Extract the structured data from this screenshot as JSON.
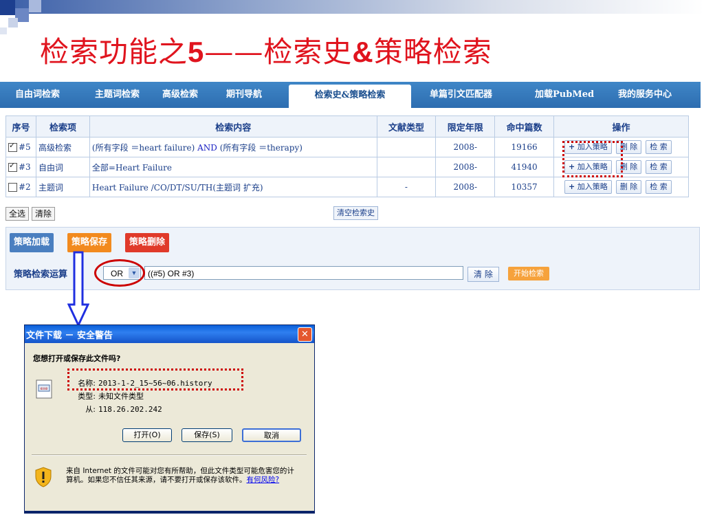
{
  "slide": {
    "title_pre": "检索功能之",
    "title_num": "5",
    "title_dash": "——",
    "title_mid": "检索史",
    "title_amp": "&",
    "title_post": "策略检索"
  },
  "tabs": [
    {
      "label": "自由词检索"
    },
    {
      "label": "主题词检索"
    },
    {
      "label": "高级检索"
    },
    {
      "label": "期刊导航"
    },
    {
      "label": "检索史&策略检索",
      "active": true
    },
    {
      "label": "单篇引文匹配器"
    },
    {
      "label": "加载PubMed"
    },
    {
      "label": "我的服务中心"
    }
  ],
  "history": {
    "headers": [
      "序号",
      "检索项",
      "检索内容",
      "文献类型",
      "限定年限",
      "命中篇数",
      "操作"
    ],
    "rows": [
      {
        "checked": true,
        "id": "#5",
        "item": "高级检索",
        "content_a": "(所有字段 ＝heart failure) ",
        "content_and": "AND",
        "content_b": " (所有字段 ＝therapy)",
        "doc_type": "",
        "year": "2008-",
        "hits": "19166"
      },
      {
        "checked": true,
        "id": "#3",
        "item": "自由词",
        "content": "全部=Heart Failure",
        "doc_type": "",
        "year": "2008-",
        "hits": "41940"
      },
      {
        "checked": false,
        "id": "#2",
        "item": "主题词",
        "content": "Heart Failure /CO/DT/SU/TH(主题词 扩充)",
        "doc_type": "-",
        "year": "2008-",
        "hits": "10357"
      }
    ],
    "ops": {
      "add_plus": "+",
      "add": "加入策略",
      "delete": "删 除",
      "search": "检 索"
    },
    "select_all": "全选",
    "clear": "清除",
    "clear_history": "清空检索史"
  },
  "strategy": {
    "load": "策略加载",
    "save": "策略保存",
    "delete": "策略删除",
    "op_label": "策略检索运算",
    "operator": "OR",
    "expression": "((#5) OR #3)",
    "clear_btn": "清 除",
    "start_btn": "开始检索"
  },
  "dialog": {
    "title": "文件下载 － 安全警告",
    "close": "✕",
    "question": "您想打开或保存此文件吗?",
    "name_label": "名称:",
    "name_value": "2013-1-2_15~56~06.history",
    "type_label": "类型:",
    "type_value": "未知文件类型",
    "from_label": "从:",
    "from_value": "118.26.202.242",
    "open_btn": "打开(O)",
    "save_btn": "保存(S)",
    "cancel_btn": "取消",
    "warning": "来自 Internet 的文件可能对您有所帮助，但此文件类型可能危害您的计算机。如果您不信任其来源，请不要打开或保存该软件。",
    "risk_link": "有何风险?"
  },
  "colors": {
    "title_red": "#e0141e",
    "tab_blue": "#2d6db0",
    "link_blue": "#1b3f8a",
    "load_btn": "#4a7fc0",
    "save_btn": "#f28a1e",
    "delete_btn": "#e03a2a",
    "annotation_red": "#cc0000",
    "arrow_blue": "#1f2fe0"
  }
}
